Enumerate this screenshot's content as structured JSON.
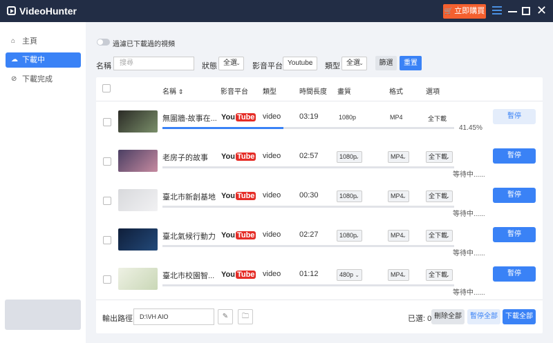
{
  "app": {
    "title": "VideoHunter",
    "buy_label": "立即購買"
  },
  "sidebar": {
    "items": [
      {
        "label": "主頁",
        "icon": "home-icon"
      },
      {
        "label": "下載中",
        "icon": "download-icon"
      },
      {
        "label": "下載完成",
        "icon": "check-circle-icon"
      }
    ]
  },
  "filters": {
    "toggle_label": "過濾已下載過的視頻",
    "name_label": "名稱",
    "search_placeholder": "搜尋",
    "status_label": "狀態",
    "status_value": "全選",
    "platform_label": "影音平台",
    "platform_value": "Youtube",
    "type_label": "類型",
    "type_value": "全選",
    "filter_btn": "篩選",
    "reset_btn": "重置"
  },
  "table": {
    "headers": {
      "name": "名稱",
      "platform": "影音平台",
      "type": "類型",
      "duration": "時間長度",
      "quality": "畫質",
      "format": "格式",
      "options": "選項"
    },
    "rows": [
      {
        "title": "無圍牆-故事在...",
        "platform": "YouTube",
        "type": "video",
        "duration": "03:19",
        "quality": "1080p",
        "format": "MP4",
        "option": "全下載",
        "status": "41.45%",
        "progress": 0.4145,
        "action": "暫停",
        "thumb": [
          "#2b2b26",
          "#7a8f6a"
        ],
        "editable": false
      },
      {
        "title": "老房子的故事",
        "platform": "YouTube",
        "type": "video",
        "duration": "02:57",
        "quality": "1080p",
        "format": "MP4",
        "option": "全下載",
        "status": "等待中......",
        "progress": 0,
        "action": "暫停",
        "thumb": [
          "#4b3f63",
          "#c68aa0"
        ],
        "editable": true
      },
      {
        "title": "臺北市新創基地",
        "platform": "YouTube",
        "type": "video",
        "duration": "00:30",
        "quality": "1080p",
        "format": "MP4",
        "option": "全下載",
        "status": "等待中......",
        "progress": 0,
        "action": "暫停",
        "thumb": [
          "#d8d9dc",
          "#f1f1f3"
        ],
        "editable": true
      },
      {
        "title": "臺北氣候行動力",
        "platform": "YouTube",
        "type": "video",
        "duration": "02:27",
        "quality": "1080p",
        "format": "MP4",
        "option": "全下載",
        "status": "等待中......",
        "progress": 0,
        "action": "暫停",
        "thumb": [
          "#0f1e3a",
          "#234a7a"
        ],
        "editable": true
      },
      {
        "title": "臺北市校園智...",
        "platform": "YouTube",
        "type": "video",
        "duration": "01:12",
        "quality": "480p",
        "format": "MP4",
        "option": "全下載",
        "status": "等待中......",
        "progress": 0,
        "action": "暫停",
        "thumb": [
          "#eef1e4",
          "#c9d7b6"
        ],
        "editable": true
      }
    ]
  },
  "footer": {
    "output_label": "輸出路徑",
    "output_path": "D:\\VH AIO",
    "selected_text": "已選: 0",
    "delete_all": "刪除全部",
    "pause_all": "暫停全部",
    "download_all": "下載全部"
  },
  "colors": {
    "accent": "#3a82f6",
    "titlebar": "#222d45",
    "buy": "#f4602f"
  }
}
